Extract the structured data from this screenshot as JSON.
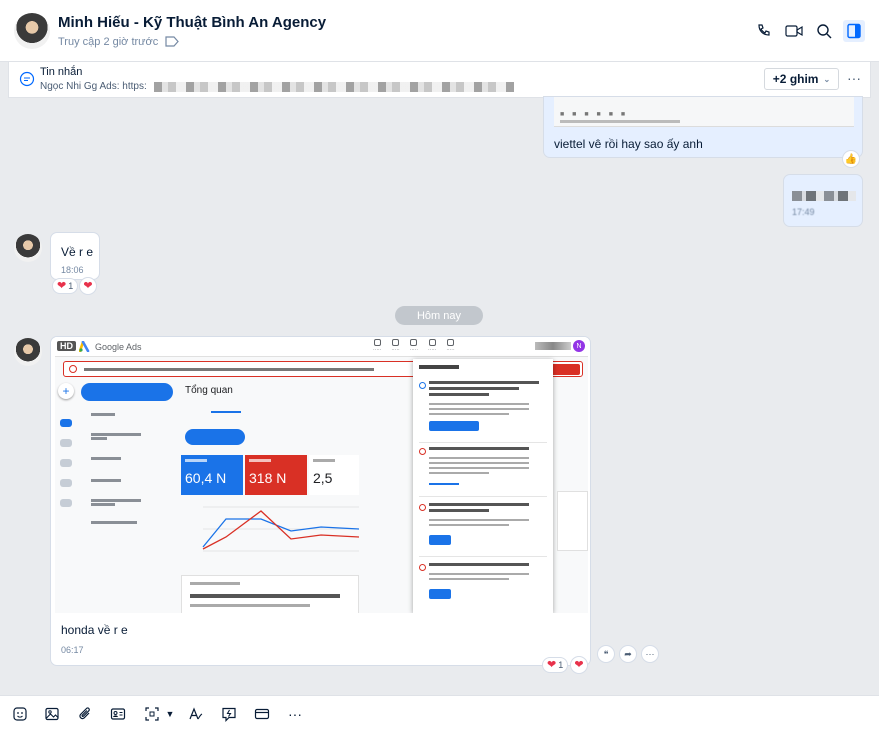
{
  "header": {
    "name": "Minh Hiếu - Kỹ Thuật Bình An Agency",
    "status": "Truy cập 2 giờ trước"
  },
  "pinned": {
    "title": "Tin nhắn",
    "preview": "Ngọc Nhi Gg Ads: https:",
    "pins_label": "+2 ghim"
  },
  "messages": {
    "top_reply": "viettel vê rồi hay sao ấy anh",
    "blurred_time": "17:49",
    "ve_text": "Về r e",
    "ve_time": "18:06",
    "ve_reaction_count": "1",
    "day_divider": "Hôm nay",
    "honda_text": "honda về r e",
    "honda_time": "06:17",
    "honda_reaction_count": "1"
  },
  "screenshot": {
    "hd": "HD",
    "app_title": "Google Ads",
    "overview": "Tổng quan",
    "stat1": "60,4 N",
    "stat2": "318 N",
    "stat3": "2,5",
    "avatar_letter": "N",
    "stat_colors": [
      "#1a73e8",
      "#d93025",
      "#ffffff"
    ]
  },
  "colors": {
    "accent": "#0068ff",
    "my_bubble": "#e5efff",
    "heart": "#e8324b"
  }
}
